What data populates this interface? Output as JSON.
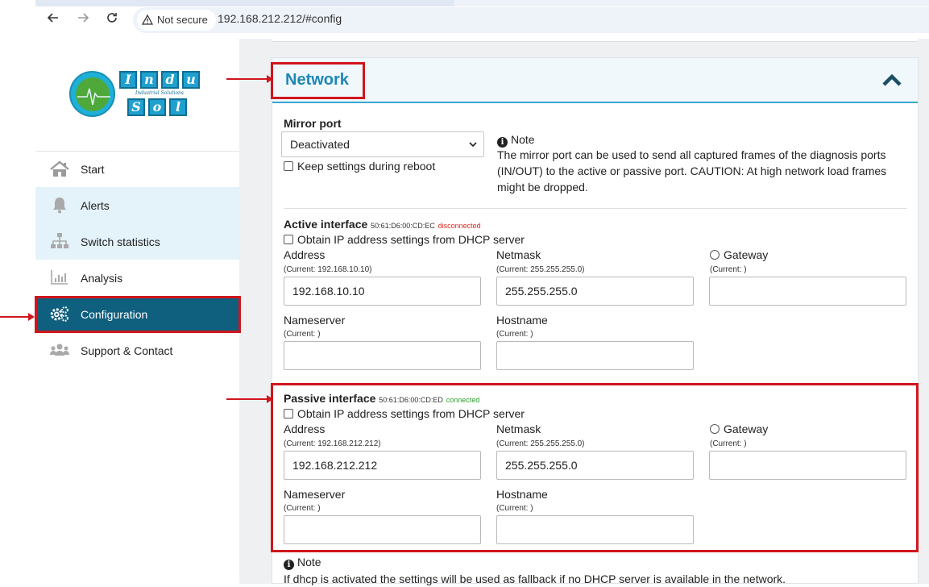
{
  "browser": {
    "back_icon": "arrow-left-icon",
    "forward_icon": "arrow-right-icon",
    "reload_icon": "reload-icon",
    "security_label": "Not secure",
    "url": "192.168.212.212/#config"
  },
  "sidebar": {
    "logo_letters_top": [
      "I",
      "n",
      "d",
      "u"
    ],
    "logo_letters_bottom": [
      "S",
      "o",
      "l"
    ],
    "logo_subtitle": "Industrial Solutions",
    "items": [
      {
        "label": "Start",
        "icon": "home-icon"
      },
      {
        "label": "Alerts",
        "icon": "bell-icon"
      },
      {
        "label": "Switch statistics",
        "icon": "network-icon"
      },
      {
        "label": "Analysis",
        "icon": "bar-chart-icon"
      },
      {
        "label": "Configuration",
        "icon": "gears-icon"
      },
      {
        "label": "Support & Contact",
        "icon": "users-icon"
      }
    ]
  },
  "panel": {
    "title": "Network",
    "mirror": {
      "label": "Mirror port",
      "selected": "Deactivated",
      "keep_label": "Keep settings during reboot",
      "note_title": "Note",
      "note_text": "The mirror port can be used to send all captured frames of the diagnosis ports (IN/OUT) to the active or passive port. CAUTION: At high network load frames might be dropped."
    },
    "active": {
      "title": "Active interface",
      "mac": "50:61:D6:00:CD:EC",
      "status": "disconnected",
      "dhcp_label": "Obtain IP address settings from DHCP server",
      "address_label": "Address",
      "address_current": "(Current: 192.168.10.10)",
      "address_value": "192.168.10.10",
      "netmask_label": "Netmask",
      "netmask_current": "(Current: 255.255.255.0)",
      "netmask_value": "255.255.255.0",
      "gateway_label": "Gateway",
      "gateway_current": "(Current: )",
      "gateway_value": "",
      "nameserver_label": "Nameserver",
      "nameserver_current": "(Current: )",
      "nameserver_value": "",
      "hostname_label": "Hostname",
      "hostname_current": "(Current: )",
      "hostname_value": ""
    },
    "passive": {
      "title": "Passive interface",
      "mac": "50:61:D6:00:CD:ED",
      "status": "connected",
      "dhcp_label": "Obtain IP address settings from DHCP server",
      "address_label": "Address",
      "address_current": "(Current: 192.168.212.212)",
      "address_value": "192.168.212.212",
      "netmask_label": "Netmask",
      "netmask_current": "(Current: 255.255.255.0)",
      "netmask_value": "255.255.255.0",
      "gateway_label": "Gateway",
      "gateway_current": "(Current: )",
      "gateway_value": "",
      "nameserver_label": "Nameserver",
      "nameserver_current": "(Current: )",
      "nameserver_value": "",
      "hostname_label": "Hostname",
      "hostname_current": "(Current: )",
      "hostname_value": ""
    },
    "bottom_note": {
      "title": "Note",
      "text": "If dhcp is activated the settings will be used as fallback if no DHCP server is available in the network."
    }
  },
  "colors": {
    "accent": "#1d88b3",
    "active_menu": "#0f5f7e",
    "annotation_red": "#d0161c",
    "connected": "#2ca02c",
    "disconnected": "#e0281f"
  }
}
